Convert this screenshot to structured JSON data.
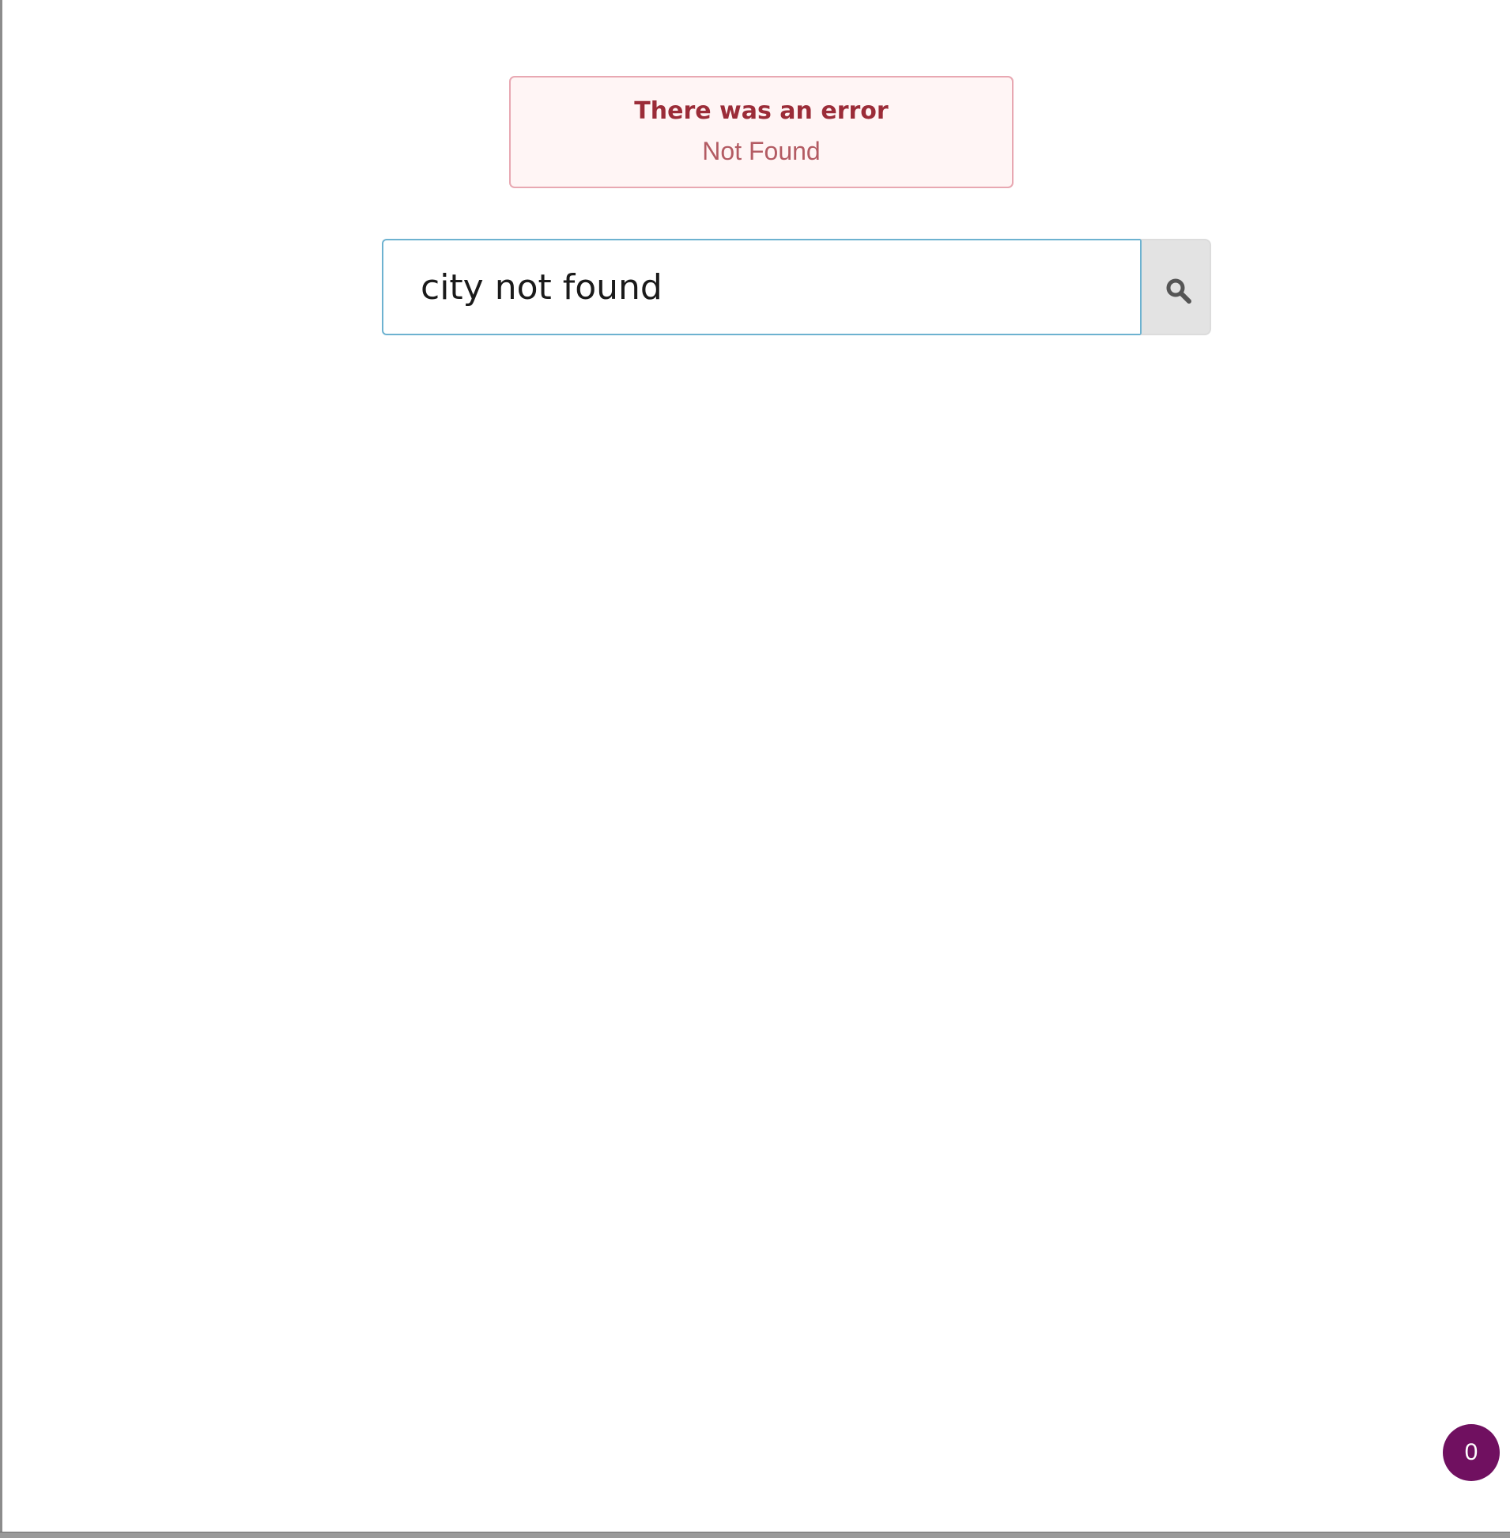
{
  "alert": {
    "title": "There was an error",
    "message": "Not Found",
    "colors": {
      "background": "#fff5f5",
      "border": "#e8a8b2",
      "title": "#9b2c38",
      "message": "#b35b63"
    }
  },
  "search": {
    "value": "city not found",
    "placeholder": "",
    "button_icon": "search-icon",
    "focus_color": "#6db2d0"
  },
  "badge": {
    "count": "0",
    "color": "#701060"
  }
}
